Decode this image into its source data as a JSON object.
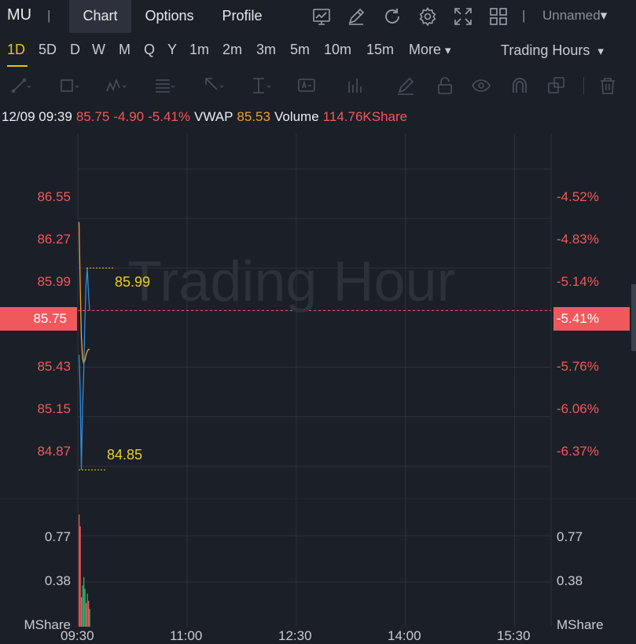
{
  "header": {
    "ticker": "MU",
    "separator": "|",
    "tabs": [
      {
        "label": "Chart",
        "active": true
      },
      {
        "label": "Options",
        "active": false
      },
      {
        "label": "Profile",
        "active": false
      }
    ],
    "icons": [
      "chart-line-icon",
      "pen-edit-icon",
      "refresh-icon",
      "gear-icon",
      "fullscreen-icon",
      "grid-layout-icon"
    ],
    "layout_name": "Unnamed",
    "layout_caret": "▾"
  },
  "periods": {
    "items": [
      "1D",
      "5D",
      "D",
      "W",
      "M",
      "Q",
      "Y",
      "1m",
      "2m",
      "3m",
      "5m",
      "10m",
      "15m"
    ],
    "active": "1D",
    "more_label": "More",
    "more_caret": "▾",
    "session_label": "Trading Hours",
    "session_caret": "▾"
  },
  "toolbar": {
    "icons": [
      "trend-line-icon",
      "rectangle-icon",
      "pattern-icon",
      "fibonacci-icon",
      "arrow-icon",
      "measure-icon",
      "text-note-icon",
      "volume-profile-icon",
      "brush-icon",
      "lock-icon",
      "eye-icon",
      "magnet-icon",
      "layers-icon",
      "trash-icon"
    ]
  },
  "quote": {
    "date_time": "12/09 09:39",
    "price": "85.75",
    "change": "-4.90",
    "change_pct": "-5.41%",
    "vwap_label": "VWAP",
    "vwap": "85.53",
    "volume_label": "Volume",
    "volume": "114.76KShare"
  },
  "colors": {
    "background": "#1b1f27",
    "down_red": "#f0595c",
    "vwap_orange": "#f0a032",
    "price_blue": "#2f8cdc",
    "annotation_yellow": "#e8d21e",
    "up_green": "#2bb36a"
  },
  "watermark": "Trading Hour",
  "chart_data": {
    "type": "line",
    "price_axis": {
      "left_ticks": [
        "86.55",
        "86.27",
        "85.99",
        "85.75",
        "85.43",
        "85.15",
        "84.87"
      ],
      "right_ticks": [
        "-4.52%",
        "-4.83%",
        "-5.14%",
        "-5.41%",
        "-5.76%",
        "-6.06%",
        "-6.37%"
      ],
      "current_price_label": "85.75",
      "current_pct_label": "-5.41%"
    },
    "volume_axis": {
      "left_ticks": [
        "0.77",
        "0.38"
      ],
      "right_ticks": [
        "0.77",
        "0.38"
      ],
      "unit": "MShare"
    },
    "time_ticks": [
      "09:30",
      "11:00",
      "12:30",
      "14:00",
      "15:30"
    ],
    "annotations": {
      "high": "85.99",
      "low": "84.85"
    },
    "series": [
      {
        "name": "Price",
        "x": [
          "09:30",
          "09:31",
          "09:32",
          "09:33",
          "09:34",
          "09:35",
          "09:36",
          "09:37",
          "09:38",
          "09:39"
        ],
        "values": [
          85.5,
          85.3,
          84.85,
          85.2,
          85.4,
          85.7,
          85.9,
          85.99,
          85.85,
          85.75
        ]
      },
      {
        "name": "VWAP",
        "x": [
          "09:30",
          "09:31",
          "09:32",
          "09:33",
          "09:34",
          "09:35",
          "09:36",
          "09:37",
          "09:38",
          "09:39"
        ],
        "values": [
          86.25,
          85.9,
          85.6,
          85.48,
          85.45,
          85.47,
          85.5,
          85.52,
          85.53,
          85.53
        ]
      }
    ],
    "volume_bars": [
      {
        "x": "09:30",
        "value": 0.95,
        "dir": "down"
      },
      {
        "x": "09:31",
        "value": 0.85,
        "dir": "down"
      },
      {
        "x": "09:32",
        "value": 0.25,
        "dir": "down"
      },
      {
        "x": "09:33",
        "value": 0.35,
        "dir": "up"
      },
      {
        "x": "09:34",
        "value": 0.42,
        "dir": "up"
      },
      {
        "x": "09:35",
        "value": 0.32,
        "dir": "up"
      },
      {
        "x": "09:36",
        "value": 0.2,
        "dir": "down"
      },
      {
        "x": "09:37",
        "value": 0.28,
        "dir": "up"
      },
      {
        "x": "09:38",
        "value": 0.22,
        "dir": "down"
      },
      {
        "x": "09:39",
        "value": 0.15,
        "dir": "up"
      }
    ],
    "price_range": [
      84.7,
      86.75
    ],
    "volume_range": [
      0,
      1.05
    ],
    "grid": true
  }
}
